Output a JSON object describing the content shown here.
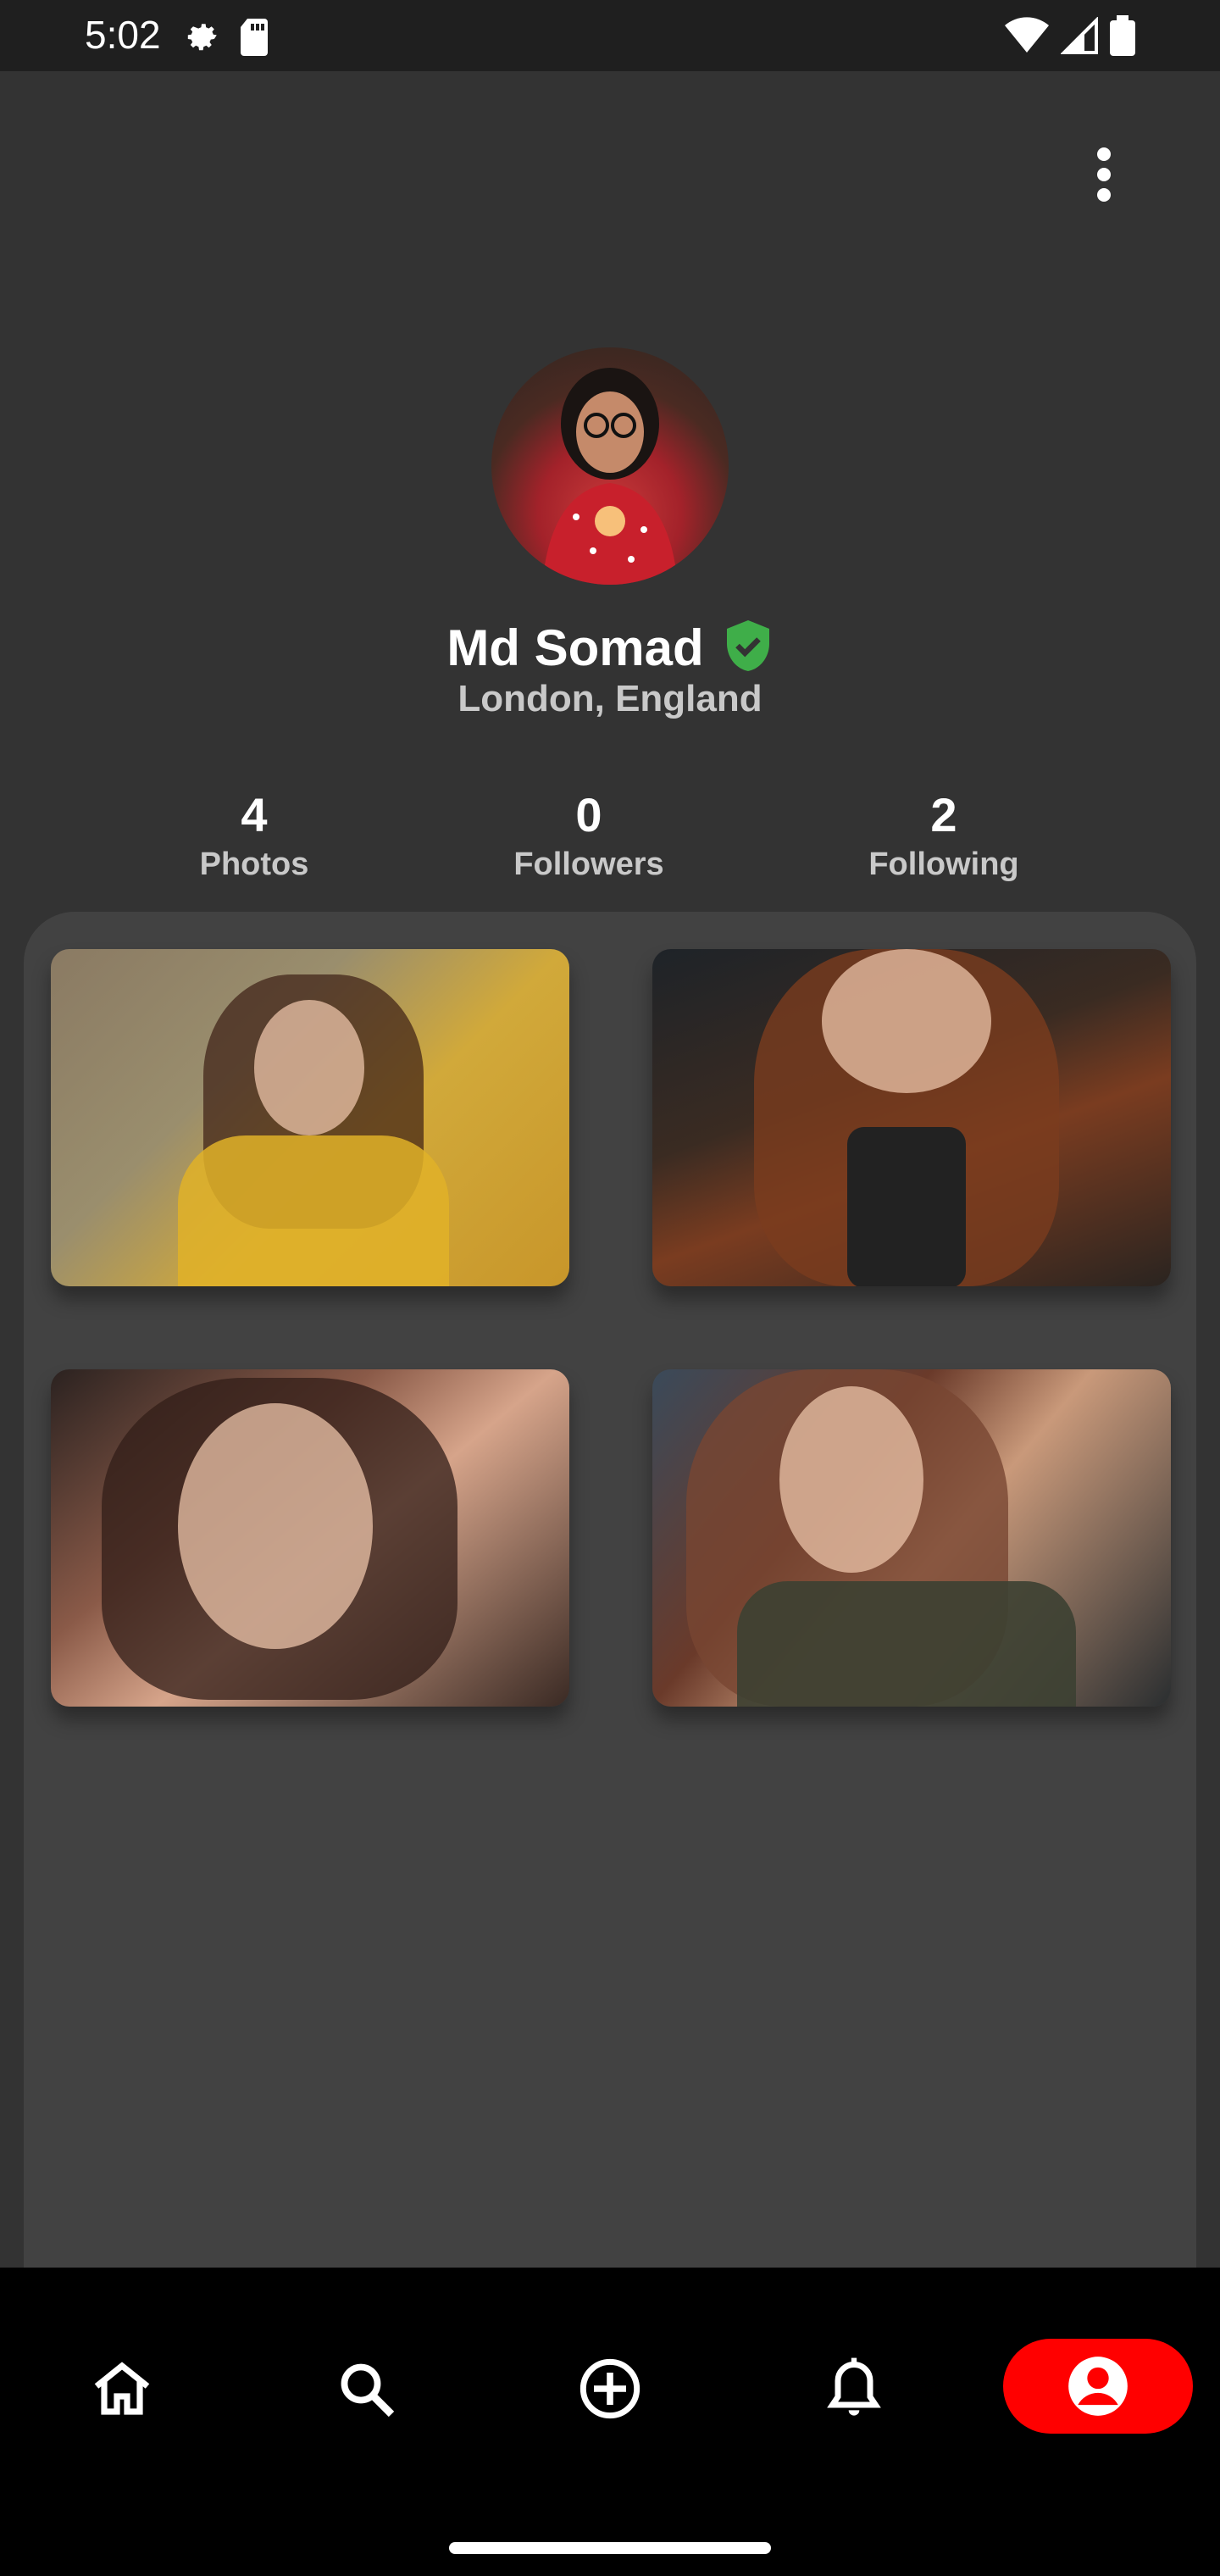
{
  "status_bar": {
    "time": "5:02",
    "left_icons": [
      "settings-icon",
      "sd-card-icon"
    ],
    "right_icons": [
      "wifi-icon",
      "signal-icon",
      "battery-icon"
    ]
  },
  "profile": {
    "name": "Md Somad",
    "verified": true,
    "verified_color": "#3fae49",
    "location": "London, England"
  },
  "stats": [
    {
      "value": "4",
      "label": "Photos"
    },
    {
      "value": "0",
      "label": "Followers"
    },
    {
      "value": "2",
      "label": "Following"
    }
  ],
  "photos": [
    {
      "name": "photo-1"
    },
    {
      "name": "photo-2"
    },
    {
      "name": "photo-3"
    },
    {
      "name": "photo-4"
    }
  ],
  "bottom_nav": {
    "items": [
      "home-icon",
      "search-icon",
      "add-circle-icon",
      "notifications-icon",
      "profile-icon"
    ],
    "active": "profile-icon",
    "active_color": "#ff0000"
  }
}
